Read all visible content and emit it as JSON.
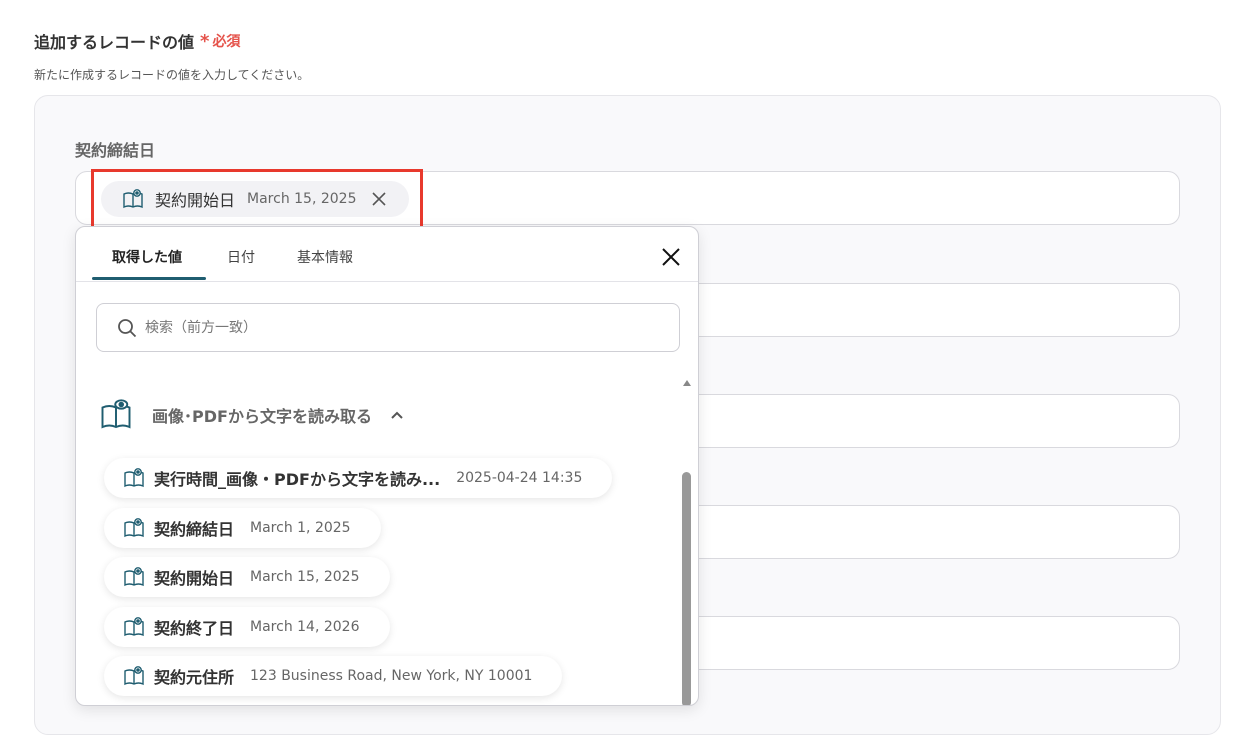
{
  "section": {
    "title": "追加するレコードの値",
    "required_star": "*",
    "required_label": "必須",
    "description": "新たに作成するレコードの値を入力してください。"
  },
  "field": {
    "label": "契約締結日",
    "chip": {
      "label": "契約開始日",
      "value": "March 15, 2025"
    }
  },
  "dropdown": {
    "tabs": [
      "取得した値",
      "日付",
      "基本情報"
    ],
    "active_tab": "取得した値",
    "search_placeholder": "検索（前方一致）",
    "group": {
      "title": "画像･PDFから文字を読み取る",
      "items": [
        {
          "label": "実行時間_画像・PDFから文字を読み...",
          "value": "2025-04-24 14:35"
        },
        {
          "label": "契約締結日",
          "value": "March 1, 2025"
        },
        {
          "label": "契約開始日",
          "value": "March 15, 2025"
        },
        {
          "label": "契約終了日",
          "value": "March 14, 2026"
        },
        {
          "label": "契約元住所",
          "value": "123 Business Road, New York, NY 10001"
        }
      ]
    }
  },
  "colors": {
    "accent": "#1f5d70",
    "required": "#e5534b",
    "highlight": "#e8392d"
  }
}
